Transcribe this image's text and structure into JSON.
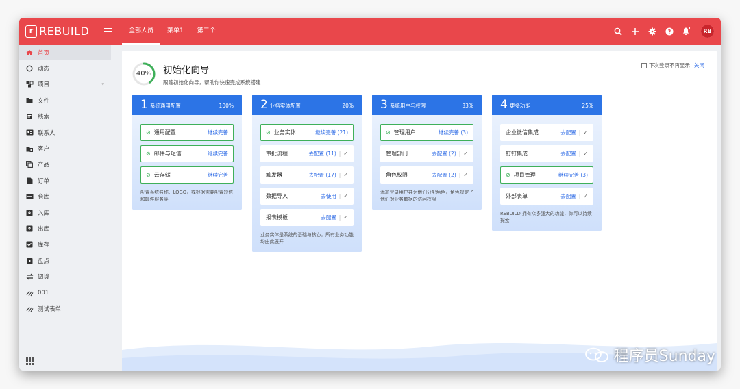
{
  "app": {
    "logo_text": "REBUILD",
    "logo_mark": "r"
  },
  "topbar": {
    "tabs": [
      "全部人员",
      "菜单1",
      "第二个"
    ],
    "active_tab": 0,
    "avatar_initials": "RB",
    "icons": [
      "search-icon",
      "plus-icon",
      "gear-icon",
      "help-icon",
      "bell-icon"
    ]
  },
  "sidebar": {
    "items": [
      {
        "label": "首页",
        "icon": "home-icon"
      },
      {
        "label": "动态",
        "icon": "circle-icon"
      },
      {
        "label": "项目",
        "icon": "project-icon",
        "has_children": true
      },
      {
        "label": "文件",
        "icon": "folder-icon"
      },
      {
        "label": "线索",
        "icon": "clue-icon"
      },
      {
        "label": "联系人",
        "icon": "contact-card-icon"
      },
      {
        "label": "客户",
        "icon": "building-icon"
      },
      {
        "label": "产品",
        "icon": "copy-icon"
      },
      {
        "label": "订单",
        "icon": "document-icon"
      },
      {
        "label": "仓库",
        "icon": "warehouse-icon"
      },
      {
        "label": "入库",
        "icon": "inbox-in-icon"
      },
      {
        "label": "出库",
        "icon": "inbox-out-icon"
      },
      {
        "label": "库存",
        "icon": "check-square-icon"
      },
      {
        "label": "盘点",
        "icon": "clipboard-icon"
      },
      {
        "label": "调拨",
        "icon": "transfer-icon"
      },
      {
        "label": "001",
        "icon": "slash-icon"
      },
      {
        "label": "测试表单",
        "icon": "slash-icon"
      }
    ],
    "active_index": 0
  },
  "wizard": {
    "progress_text": "40%",
    "progress": 0.4,
    "title": "初始化向导",
    "subtitle": "跟随初始化向导，帮助你快速完成系统搭建",
    "dont_show_label": "下次登录不再显示",
    "close_label": "关闭"
  },
  "cards": [
    {
      "num": "1",
      "name": "系统通用配置",
      "pct": "100%",
      "items": [
        {
          "label": "通用配置",
          "action": "继续完善",
          "done": true
        },
        {
          "label": "邮件与短信",
          "action": "继续完善",
          "done": true
        },
        {
          "label": "云存储",
          "action": "继续完善",
          "done": true
        }
      ],
      "desc": "配置系统名称、LOGO，或根据需要配置短信和邮件服务等"
    },
    {
      "num": "2",
      "name": "业务实体配置",
      "pct": "20%",
      "items": [
        {
          "label": "业务实体",
          "action": "继续完善 (21)",
          "done": true
        },
        {
          "label": "审批流程",
          "action": "去配置 (11)",
          "done": false
        },
        {
          "label": "触发器",
          "action": "去配置 (17)",
          "done": false
        },
        {
          "label": "数据导入",
          "action": "去使用",
          "done": false
        },
        {
          "label": "报表模板",
          "action": "去配置",
          "done": false
        }
      ],
      "desc": "业务实体是系统的基础与核心，所有业务功能均由此展开"
    },
    {
      "num": "3",
      "name": "系统用户与权限",
      "pct": "33%",
      "items": [
        {
          "label": "管理用户",
          "action": "继续完善 (3)",
          "done": true
        },
        {
          "label": "管理部门",
          "action": "去配置 (2)",
          "done": false
        },
        {
          "label": "角色权限",
          "action": "去配置 (2)",
          "done": false
        }
      ],
      "desc": "添加登录用户并为他们分配角色，角色规定了他们对业务数据的访问权限"
    },
    {
      "num": "4",
      "name": "更多功能",
      "pct": "25%",
      "items": [
        {
          "label": "企业微信集成",
          "action": "去配置",
          "done": false
        },
        {
          "label": "钉钉集成",
          "action": "去配置",
          "done": false
        },
        {
          "label": "项目管理",
          "action": "继续完善 (3)",
          "done": true
        },
        {
          "label": "外部表单",
          "action": "去配置",
          "done": false
        }
      ],
      "desc": "REBUILD 拥有众多强大的功能，你可以持续探索"
    }
  ],
  "watermark": {
    "text": "程序员Sunday"
  },
  "colors": {
    "brand": "#e9474b",
    "primary": "#2c74e6",
    "success": "#3fb05a",
    "link": "#2e6be6"
  }
}
